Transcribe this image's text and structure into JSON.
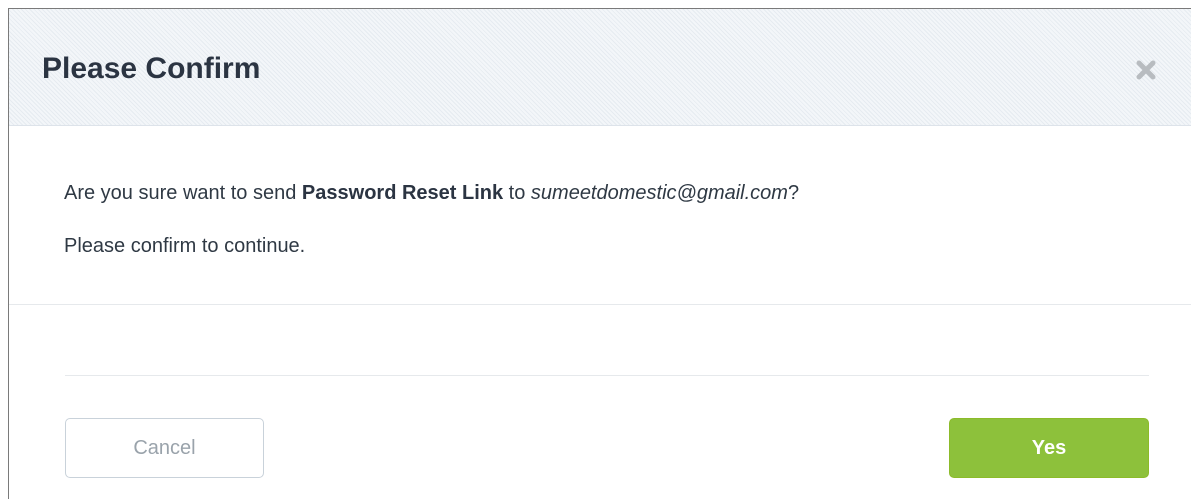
{
  "dialog": {
    "title": "Please Confirm",
    "close_icon": "close-icon",
    "message": {
      "prefix": "Are you sure want to send ",
      "action": "Password Reset Link",
      "middle": " to ",
      "email": "sumeetdomestic@gmail.com",
      "suffix": "?"
    },
    "instruction": "Please confirm to continue.",
    "buttons": {
      "cancel_label": "Cancel",
      "yes_label": "Yes"
    }
  },
  "colors": {
    "accent_green": "#8dc13b",
    "title_text": "#2b3442",
    "cancel_text": "#9aa3ab"
  }
}
